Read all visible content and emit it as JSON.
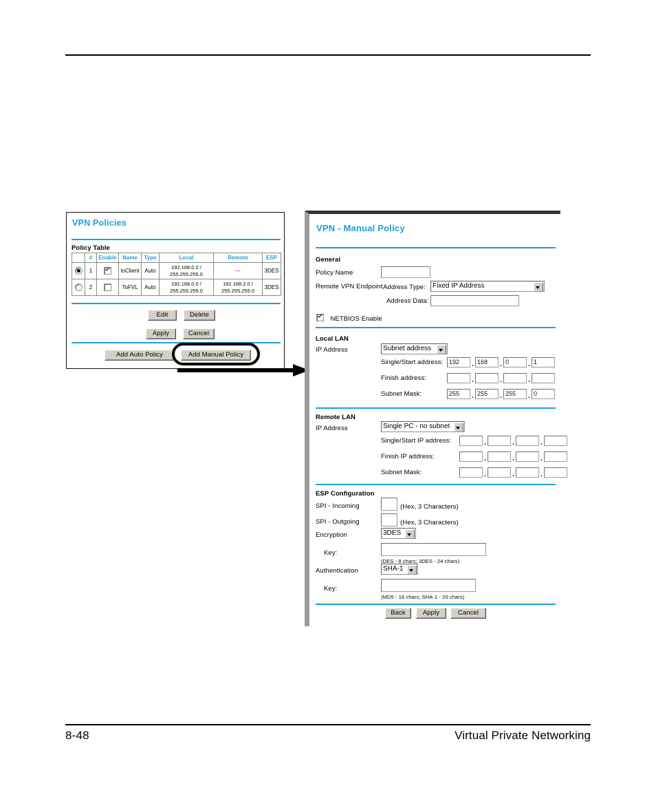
{
  "page": {
    "footer_page_number": "8-48",
    "footer_section_title": "Virtual Private Networking",
    "accent_blue": "#1d9fd8"
  },
  "vpn_policies": {
    "title": "VPN Policies",
    "table_label": "Policy Table",
    "columns": [
      "",
      "#",
      "Enable",
      "Name",
      "Type",
      "Local",
      "Remote",
      "ESP"
    ],
    "rows": [
      {
        "selected": true,
        "number": "1",
        "enabled": true,
        "name": "toClient",
        "type": "Auto",
        "local_line1": "192.168.0.0 /",
        "local_line2": "255.255.255.0",
        "remote_line1": "---",
        "remote_line2": "",
        "esp": "3DES"
      },
      {
        "selected": false,
        "number": "2",
        "enabled": false,
        "name": "ToFVL",
        "type": "Auto",
        "local_line1": "192.168.0.0 /",
        "local_line2": "255.255.255.0",
        "remote_line1": "192.168.2.0 /",
        "remote_line2": "255.255.255.0",
        "esp": "3DES"
      }
    ],
    "buttons": {
      "edit": "Edit",
      "delete": "Delete",
      "apply": "Apply",
      "cancel": "Cancel",
      "add_auto_policy": "Add Auto Policy",
      "add_manual_policy": "Add Manual Policy"
    }
  },
  "manual_policy": {
    "title": "VPN - Manual Policy",
    "general": {
      "section_label": "General",
      "policy_name_label": "Policy Name",
      "policy_name_value": "",
      "remote_endpoint_label": "Remote VPN Endpoint",
      "address_type_label": "Address Type:",
      "address_type_value": "Fixed IP Address",
      "address_data_label": "Address Data:",
      "address_data_value": "",
      "netbios_label": "NETBIOS Enable",
      "netbios_checked": true
    },
    "local_lan": {
      "section_label": "Local LAN",
      "ip_address_label": "IP Address",
      "ip_mode_value": "Subnet address",
      "start_label": "Single/Start address:",
      "start_octets": [
        "192",
        "168",
        "0",
        "1"
      ],
      "finish_label": "Finish address:",
      "finish_octets": [
        "",
        "",
        "",
        ""
      ],
      "mask_label": "Subnet Mask:",
      "mask_octets": [
        "255",
        "255",
        "255",
        "0"
      ]
    },
    "remote_lan": {
      "section_label": "Remote LAN",
      "ip_address_label": "IP Address",
      "ip_mode_value": "Single PC - no subnet",
      "start_label": "Single/Start IP address:",
      "start_octets": [
        "",
        "",
        "",
        ""
      ],
      "finish_label": "Finish IP address:",
      "finish_octets": [
        "",
        "",
        "",
        ""
      ],
      "mask_label": "Subnet Mask:",
      "mask_octets": [
        "",
        "",
        "",
        ""
      ]
    },
    "esp": {
      "section_label": "ESP Configuration",
      "spi_incoming_label": "SPI - Incoming",
      "spi_incoming_value": "",
      "spi_incoming_hint": "(Hex, 3 Characters)",
      "spi_outgoing_label": "SPI - Outgoing",
      "spi_outgoing_value": "",
      "spi_outgoing_hint": "(Hex, 3 Characters)",
      "encryption_label": "Encryption",
      "encryption_value": "3DES",
      "encryption_key_label": "Key:",
      "encryption_key_value": "",
      "encryption_key_hint": "(DES - 8 chars;  3DES - 24 chars)",
      "authentication_label": "Authentication",
      "authentication_value": "SHA-1",
      "authentication_key_label": "Key:",
      "authentication_key_value": "",
      "authentication_key_hint": "(MD5 - 16 chars;  SHA-1 - 20 chars)"
    },
    "buttons": {
      "back": "Back",
      "apply": "Apply",
      "cancel": "Cancel"
    }
  }
}
